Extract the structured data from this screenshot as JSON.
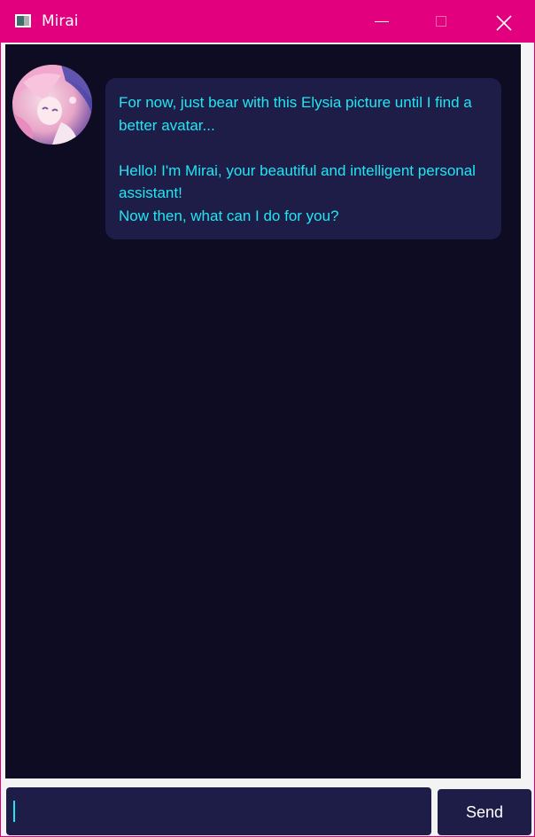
{
  "window": {
    "title": "Mirai",
    "titlebar_color": "#e3007e",
    "controls": {
      "minimize_icon": "minimize-icon",
      "maximize_icon": "maximize-icon",
      "close_icon": "close-icon"
    }
  },
  "chat": {
    "background_color": "#0d0c23",
    "messages": [
      {
        "sender_avatar": "avatar-image",
        "text": "For now, just bear with this Elysia picture until I find a better avatar...\n\nHello! I'm Mirai, your beautiful and intelligent personal assistant!\nNow then, what can I do for you?",
        "text_color": "#21e6f2",
        "bubble_color": "#1e1d48"
      }
    ]
  },
  "composer": {
    "input_value": "",
    "send_label": "Send"
  }
}
